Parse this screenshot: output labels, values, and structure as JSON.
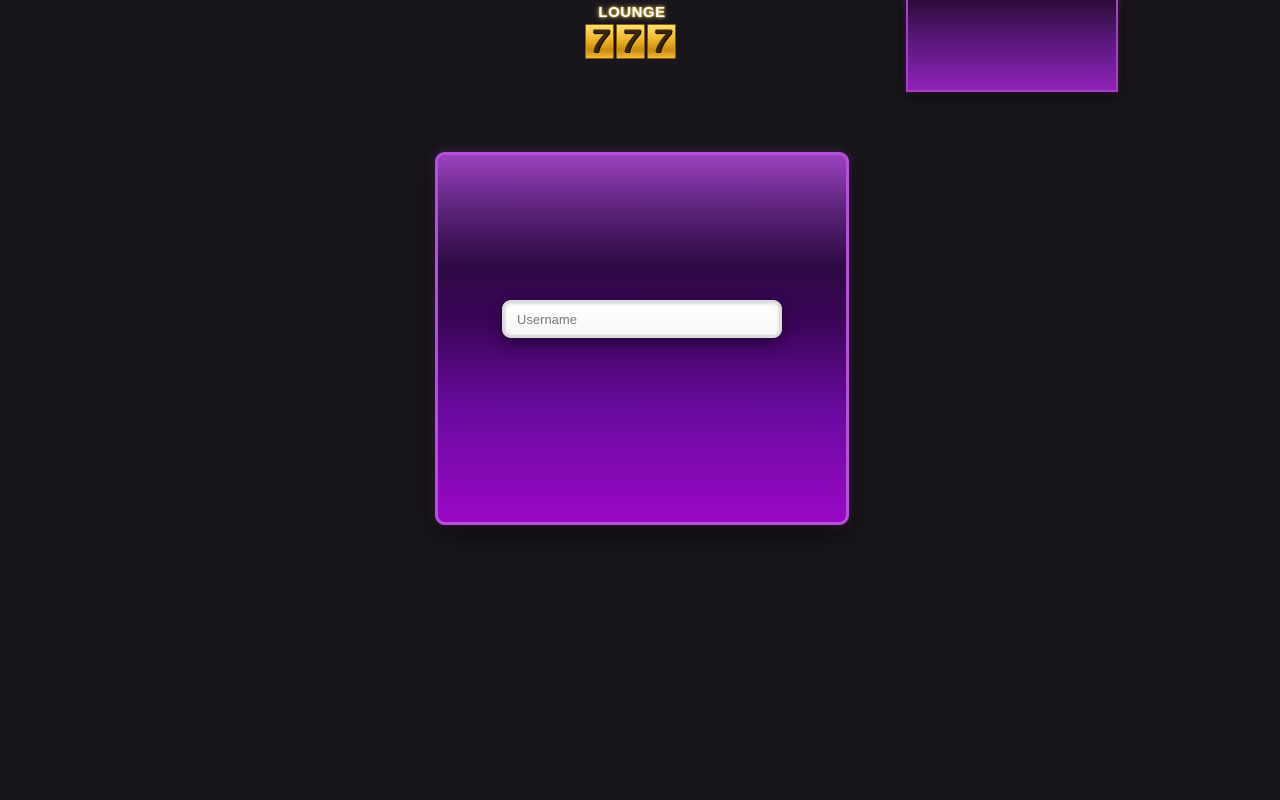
{
  "logo": {
    "word": "LOUNGE",
    "reels": [
      "7",
      "7",
      "7"
    ]
  },
  "login": {
    "username_placeholder": "Username",
    "username_value": ""
  },
  "colors": {
    "background": "#18161b",
    "card_border": "#b550d8",
    "card_top": "#9a42c0",
    "card_bottom": "#9a08c5",
    "logo_gold": "#f0b52a"
  }
}
